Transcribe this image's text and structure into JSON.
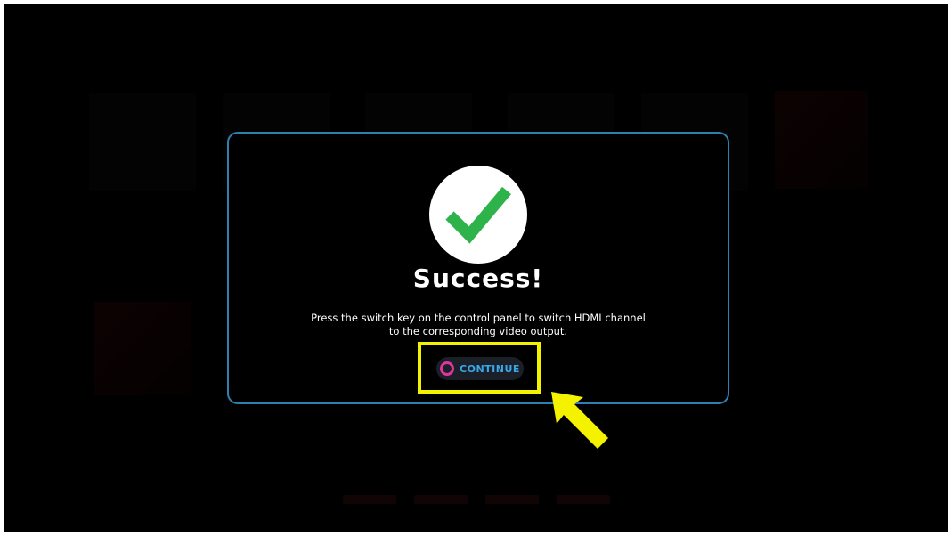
{
  "dialog": {
    "title": "Success!",
    "message_line1": "Press the switch key on the control panel to switch HDMI channel",
    "message_line2": "to the corresponding video output.",
    "continue_label": "CONTINUE",
    "status_icon": "check-icon",
    "button_icon": "circle-button-icon"
  },
  "annotations": {
    "highlight_color": "#f5f200",
    "arrow_icon": "pointer-arrow-icon"
  },
  "colors": {
    "modal_border": "#2f7fb0",
    "check_green": "#2db34a",
    "button_text": "#3aa8e8",
    "button_icon": "#e0359a"
  }
}
